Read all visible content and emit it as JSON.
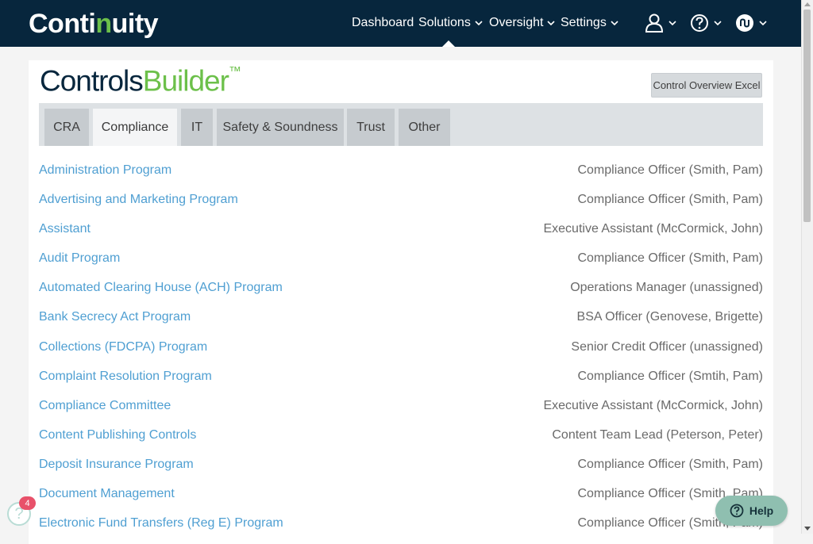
{
  "app": {
    "logo_left": "Conti",
    "logo_accent": "n",
    "logo_right": "uity"
  },
  "nav": {
    "dashboard": "Dashboard",
    "solutions": "Solutions",
    "oversight": "Oversight",
    "settings": "Settings"
  },
  "brand": {
    "part1": "Controls",
    "part2": "Builder",
    "tm": "™"
  },
  "excel_button": "Control Overview Excel",
  "tabs": [
    {
      "label": "CRA"
    },
    {
      "label": "Compliance"
    },
    {
      "label": "IT"
    },
    {
      "label": "Safety & Soundness"
    },
    {
      "label": "Trust"
    },
    {
      "label": "Other"
    }
  ],
  "active_tab": "Compliance",
  "programs": [
    {
      "name": "Administration Program",
      "owner": "Compliance Officer (Smith, Pam)"
    },
    {
      "name": "Advertising and Marketing Program",
      "owner": "Compliance Officer (Smith, Pam)"
    },
    {
      "name": "Assistant",
      "owner": "Executive Assistant (McCormick, John)"
    },
    {
      "name": "Audit Program",
      "owner": "Compliance Officer (Smith, Pam)"
    },
    {
      "name": "Automated Clearing House (ACH) Program",
      "owner": "Operations Manager (unassigned)"
    },
    {
      "name": "Bank Secrecy Act Program",
      "owner": "BSA Officer (Genovese, Brigette)"
    },
    {
      "name": "Collections (FDCPA) Program",
      "owner": "Senior Credit Officer (unassigned)"
    },
    {
      "name": "Complaint Resolution Program",
      "owner": "Compliance Officer (Smtih, Pam)"
    },
    {
      "name": "Compliance Committee",
      "owner": "Executive Assistant (McCormick, John)"
    },
    {
      "name": "Content Publishing Controls",
      "owner": "Content Team Lead (Peterson, Peter)"
    },
    {
      "name": "Deposit Insurance Program",
      "owner": "Compliance Officer (Smith, Pam)"
    },
    {
      "name": "Document Management",
      "owner": "Compliance Officer (Smith, Pam)"
    },
    {
      "name": "Electronic Fund Transfers (Reg E) Program",
      "owner": "Compliance Officer (Smith, Pam)"
    }
  ],
  "help_widget": {
    "badge_count": "4",
    "label": "Help"
  },
  "colors": {
    "navbar": "#07263d",
    "brand_green": "#6cc04a",
    "link": "#4f9fd2",
    "help_button": "#8fbfb0"
  }
}
